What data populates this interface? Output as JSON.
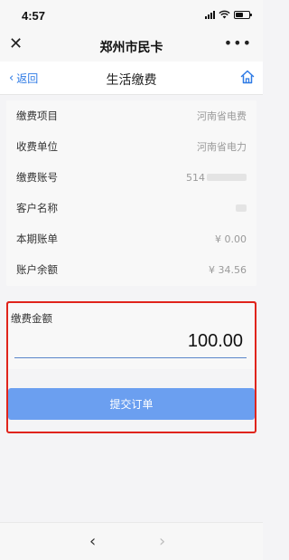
{
  "status_bar": {
    "time": "4:57"
  },
  "title_bar": {
    "close_icon": "✕",
    "title": "郑州市民卡",
    "more_icon": "•••"
  },
  "nav_bar": {
    "back_chevron": "‹",
    "back_label": "返回",
    "title": "生活缴费"
  },
  "info": {
    "rows": [
      {
        "label": "缴费项目",
        "value": "河南省电费"
      },
      {
        "label": "收费单位",
        "value": "河南省电力"
      },
      {
        "label": "缴费账号",
        "value": "514"
      },
      {
        "label": "客户名称",
        "value": ""
      },
      {
        "label": "本期账单",
        "value": "¥ 0.00"
      },
      {
        "label": "账户余额",
        "value": "¥ 34.56"
      }
    ]
  },
  "payment": {
    "label": "缴费金额",
    "amount": "100.00"
  },
  "submit": {
    "label": "提交订单"
  },
  "bottom_bar": {
    "back_icon": "‹",
    "forward_icon": "›"
  },
  "colors": {
    "accent": "#2d7ae5",
    "button": "#6b9ff0",
    "highlight_border": "#e0241b"
  }
}
